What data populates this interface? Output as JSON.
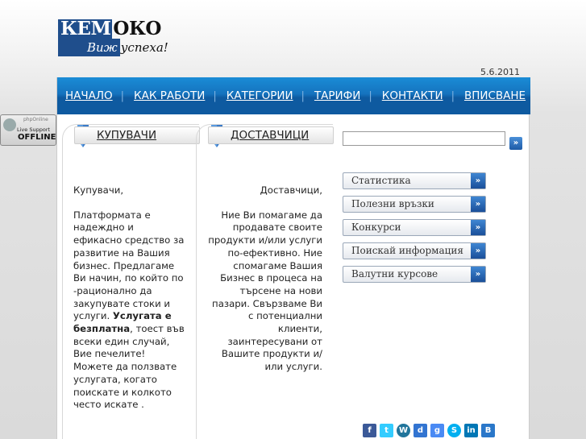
{
  "logo": {
    "part1": "КЕМ",
    "part2": "ОКО",
    "tagline1": "Виж",
    "tagline2": "успеха!"
  },
  "date": "5.6.2011",
  "nav": [
    "НАЧАЛО",
    "КАК РАБОТИ",
    "КАТЕГОРИИ",
    "ТАРИФИ",
    "КОНТАКТИ",
    "ВПИСВАНЕ"
  ],
  "buyers": {
    "title": "КУПУВАЧИ",
    "heading": "Купувачи,",
    "text_before": "Платформата е надеждно и ефикасно средство за развитие на Вашия бизнес. Предлагаме Ви начин, по който по -рационално да закупувате стоки и услуги.",
    "bold": "Услугата е безплатна",
    "text_after": ", тоест във всеки един случай, Вие печелите! Можете да ползвате услугата, когато поискате и колкото често искате ."
  },
  "suppliers": {
    "title": "ДОСТАВЧИЦИ",
    "heading": "Доставчици,",
    "text": "Ние Ви помагаме да продавате своите продукти и/или услуги по-ефективно. Ние спомагаме Вашия Бизнес в процеса на търсене на нови пазари. Свързваме Ви с потенциални клиенти, заинтересувани от Вашите продукти и/или услуги."
  },
  "search": {
    "value": ""
  },
  "sidebar": [
    "Статистика",
    "Полезни връзки",
    "Конкурси",
    "Поискай информация",
    "Валутни курсове"
  ],
  "support": {
    "brand": "phpOnline",
    "line1": "Live Support",
    "status": "OFFLINE"
  },
  "social": [
    "facebook-icon",
    "twitter-icon",
    "wordpress-icon",
    "delicious-icon",
    "google-icon",
    "skype-icon",
    "linkedin-icon",
    "blogger-icon"
  ]
}
